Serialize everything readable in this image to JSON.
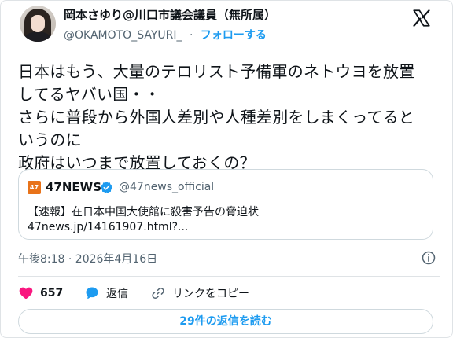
{
  "author": {
    "display_name": "岡本さゆり@川口市議会議員（無所属）",
    "handle": "@OKAMOTO_SAYURI_",
    "separator": "·",
    "follow_label": "フォローする"
  },
  "tweet": {
    "lines": [
      "日本はもう、大量のテロリスト予備軍のネトウヨを放置",
      "してるヤバい国・・",
      "さらに普段から外国人差別や人種差別をしまくってると",
      "いうのに",
      "政府はいつまで放置しておくの？"
    ]
  },
  "quote": {
    "logo_text": "47",
    "name": "47NEWS",
    "handle": "@47news_official",
    "title": "【速報】在日本中国大使館に殺害予告の脅迫状",
    "link": "47news.jp/14161907.html?..."
  },
  "timestamp": "午後8:18 · 2026年4月16日",
  "actions": {
    "like_count": "657",
    "reply_label": "返信",
    "copy_label": "リンクをコピー"
  },
  "read_replies_label": "29件の返信を読む",
  "colors": {
    "accent": "#1d9bf0",
    "like": "#f91880",
    "text": "#0f1419",
    "secondary": "#536471"
  }
}
